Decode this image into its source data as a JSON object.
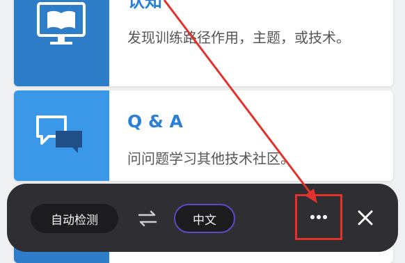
{
  "cards": [
    {
      "title": "认知",
      "description": "发现训练路径作用，主题，或技术。",
      "icon": "monitor-book-icon"
    },
    {
      "title": "Q & A",
      "description": "问问题学习其他技术社区。",
      "icon": "chat-bubbles-icon"
    }
  ],
  "translate_bar": {
    "source_language": "自动检测",
    "target_language": "中文",
    "swap_icon": "swap-arrows-icon",
    "more_icon": "more-horizontal-icon",
    "close_icon": "close-icon"
  },
  "annotation": {
    "color": "#e2322c"
  },
  "colors": {
    "card_icon_dark": "#2e7dc8",
    "card_icon_light": "#3b97e8",
    "title": "#2b7fd4",
    "toolbar_bg": "#2f2f33",
    "target_pill_border": "#5a4bc7"
  }
}
